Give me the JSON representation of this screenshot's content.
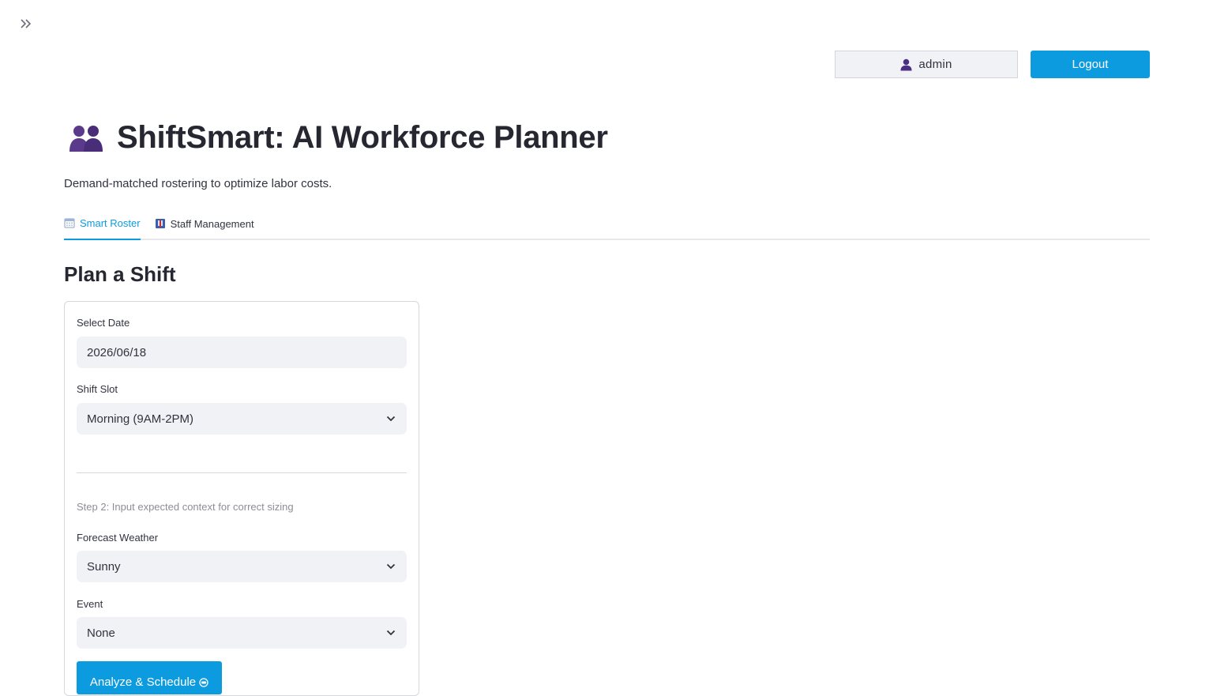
{
  "header": {
    "user_name": "admin",
    "logout_label": "Logout"
  },
  "page": {
    "title": "ShiftSmart: AI Workforce Planner",
    "subtitle": "Demand-matched rostering to optimize labor costs."
  },
  "tabs": [
    {
      "label": "Smart Roster",
      "icon": "calendar-icon",
      "active": true
    },
    {
      "label": "Staff Management",
      "icon": "staff-card-icon",
      "active": false
    }
  ],
  "form": {
    "section_title": "Plan a Shift",
    "date_label": "Select Date",
    "date_value": "2026/06/18",
    "shift_label": "Shift Slot",
    "shift_value": "Morning (9AM-2PM)",
    "step_caption": "Step 2: Input expected context for correct sizing",
    "weather_label": "Forecast Weather",
    "weather_value": "Sunny",
    "event_label": "Event",
    "event_value": "None",
    "submit_label": "Analyze & Schedule"
  },
  "colors": {
    "accent": "#0d9be0",
    "title_icon": "#5b3a8c"
  }
}
